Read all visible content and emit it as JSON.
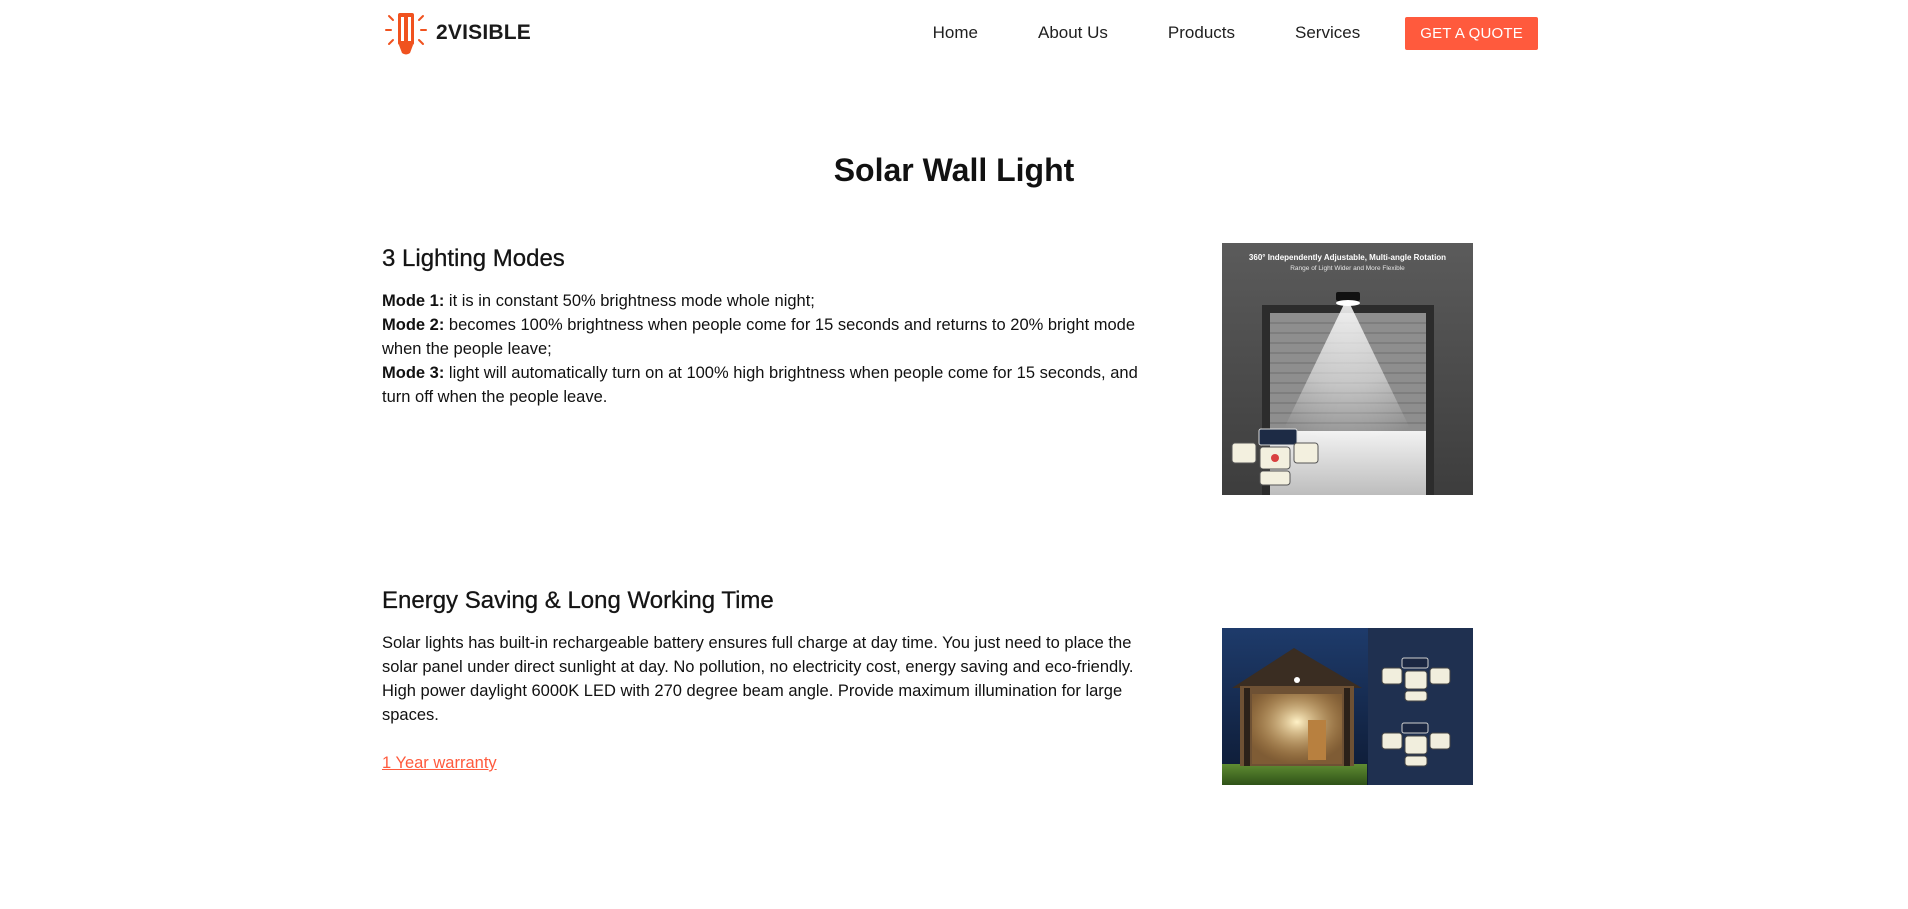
{
  "header": {
    "logo_text": "2VISIBLE",
    "nav": {
      "home": "Home",
      "about": "About Us",
      "products": "Products",
      "services": "Services"
    },
    "cta_label": "GET A QUOTE"
  },
  "page": {
    "title": "Solar Wall Light"
  },
  "section_modes": {
    "heading": "3 Lighting Modes",
    "modes": [
      {
        "label": "Mode 1:",
        "text": " it is in constant 50% brightness mode whole night;"
      },
      {
        "label": "Mode 2:",
        "text": " becomes 100% brightness when people come for 15 seconds and returns to 20% bright mode when the people leave;"
      },
      {
        "label": "Mode 3:",
        "text": " light will automatically turn on at 100% high brightness when people come for 15 seconds, and turn off when the people leave."
      }
    ],
    "image": {
      "caption_main": "360° Independently Adjustable, Multi-angle Rotation",
      "caption_sub": "Range of Light Wider and More Flexible"
    }
  },
  "section_energy": {
    "heading": "Energy Saving & Long Working Time",
    "paragraph_1": "Solar lights has built-in rechargeable battery ensures full charge at day time. You just need to place the solar panel under direct sunlight at day. No pollution, no electricity cost, energy saving and eco-friendly.",
    "paragraph_2": "High power daylight 6000K LED with 270 degree beam angle. Provide maximum illumination for large spaces.",
    "warranty_link": "1 Year warranty"
  },
  "colors": {
    "accent": "#ff5a3d",
    "text": "#111111"
  }
}
